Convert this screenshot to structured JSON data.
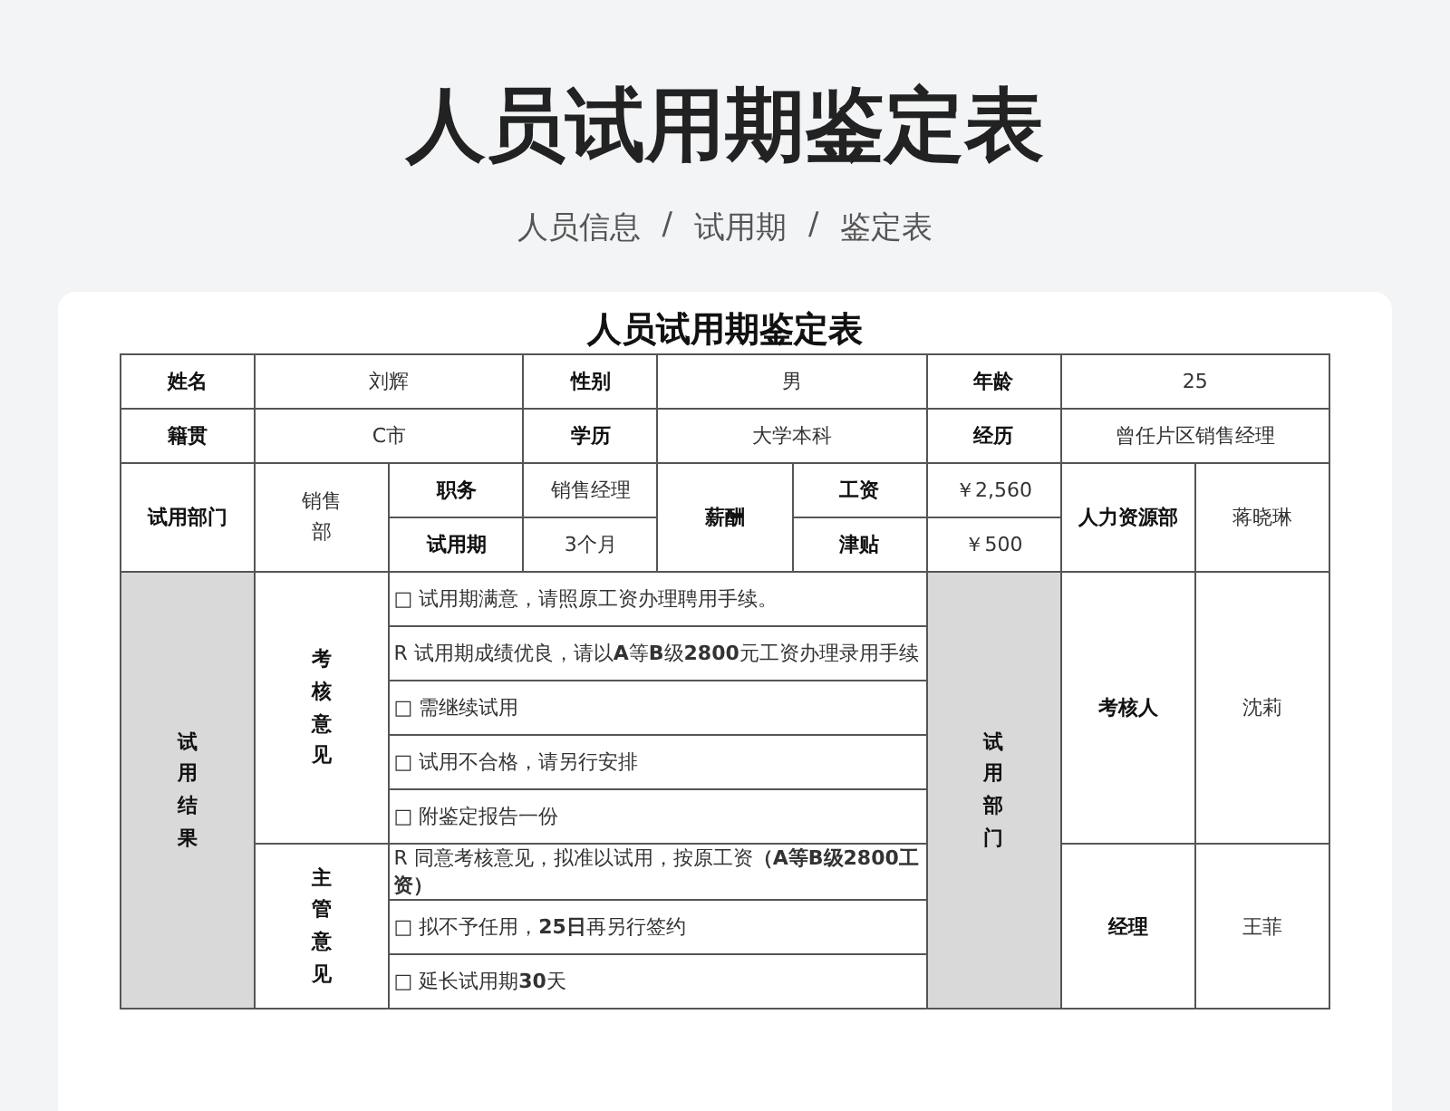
{
  "page_title": "人员试用期鉴定表",
  "breadcrumb": {
    "separator": "/",
    "items": [
      "人员信息",
      "试用期",
      "鉴定表"
    ]
  },
  "form": {
    "title": "人员试用期鉴定表",
    "row_1": [
      {
        "label": "姓名",
        "value": "刘辉"
      },
      {
        "label": "性别",
        "value": "男"
      },
      {
        "label": "年龄",
        "value": "25"
      }
    ],
    "row_2": [
      {
        "label": "籍贯",
        "value": "C市"
      },
      {
        "label": "学历",
        "value": "大学本科"
      },
      {
        "label": "经历",
        "value": "曾任片区销售经理"
      }
    ],
    "department": {
      "label": "试用部门",
      "value": "销售部"
    },
    "position": {
      "label": "职务",
      "value": "销售经理"
    },
    "probation_period": {
      "label": "试用期",
      "value": "3个月"
    },
    "pay_label": "薪酬",
    "wage": {
      "label": "工资",
      "value": "￥2,560"
    },
    "allowance": {
      "label": "津贴",
      "value": "￥500"
    },
    "hr": {
      "label": "人力资源部",
      "value": "蒋晓琳"
    },
    "result_label": "试用结果",
    "dept_label": "试用部门",
    "sections": [
      {
        "label": "考核意见",
        "options": [
          "□ 试用期满意，请照原工资办理聘用手续。",
          "R 试用期成绩优良，请以**A**等**B**级**2800**元工资办理录用手续",
          "□ 需继续试用",
          "□ 试用不合格，请另行安排",
          "□ 附鉴定报告一份"
        ],
        "signer": {
          "label": "考核人",
          "value": "沈莉"
        }
      },
      {
        "label": "主管意见",
        "options": [
          "R 同意考核意见，拟准以试用，按原工资**（A等B级2800工资）**",
          "□ 拟不予任用，**25日**再另行签约",
          "□ 延长试用期**30**天"
        ],
        "signer": {
          "label": "经理",
          "value": "王菲"
        }
      }
    ]
  }
}
